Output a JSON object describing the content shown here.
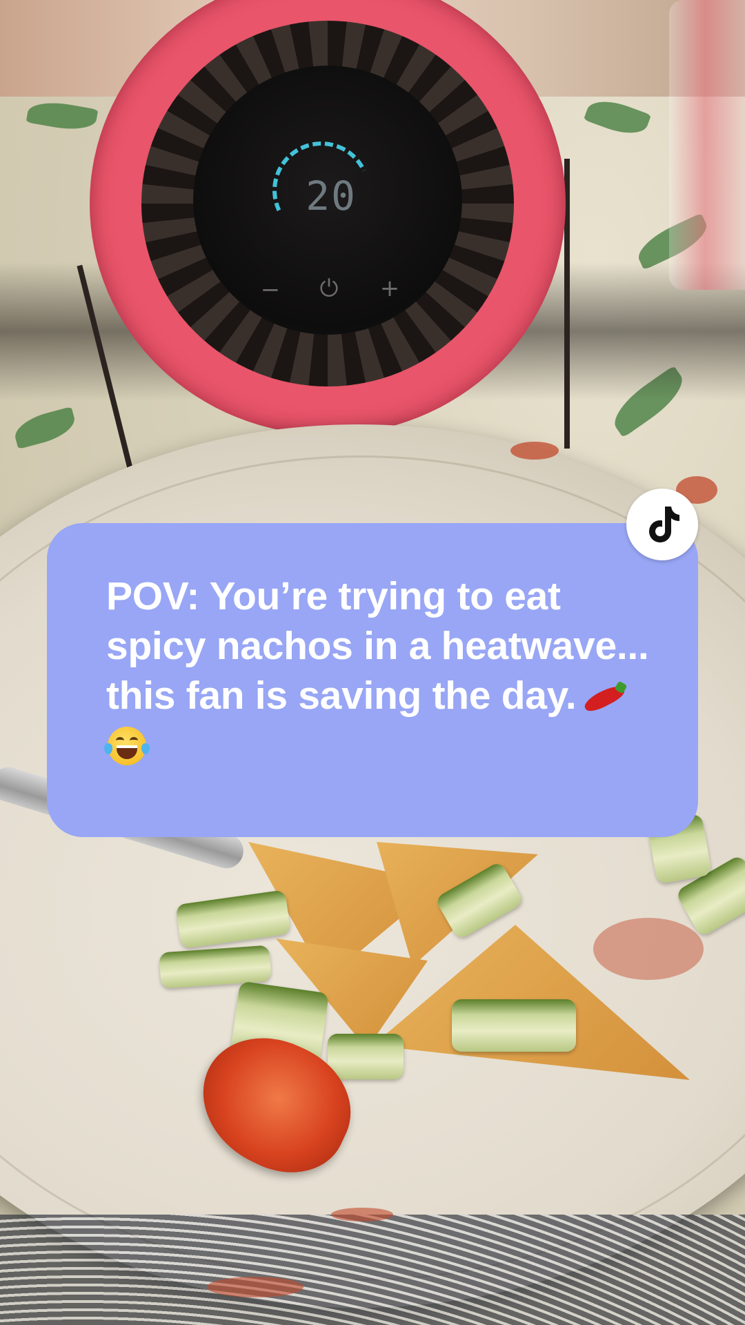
{
  "caption": {
    "text": "POV: You’re trying to eat spicy nachos in a heatwave... this fan is saving the day.",
    "emojis": [
      "chili-pepper",
      "face-with-tears-of-joy"
    ],
    "background_color": "#98a6f5",
    "text_color": "#ffffff"
  },
  "fan": {
    "display_value": "20",
    "ring_color": "#e9556a",
    "arc_color": "#43c2d9",
    "buttons": {
      "minus": "−",
      "power": "⏻",
      "plus": "+"
    }
  },
  "badge": {
    "icon": "tiktok-logo-icon"
  }
}
